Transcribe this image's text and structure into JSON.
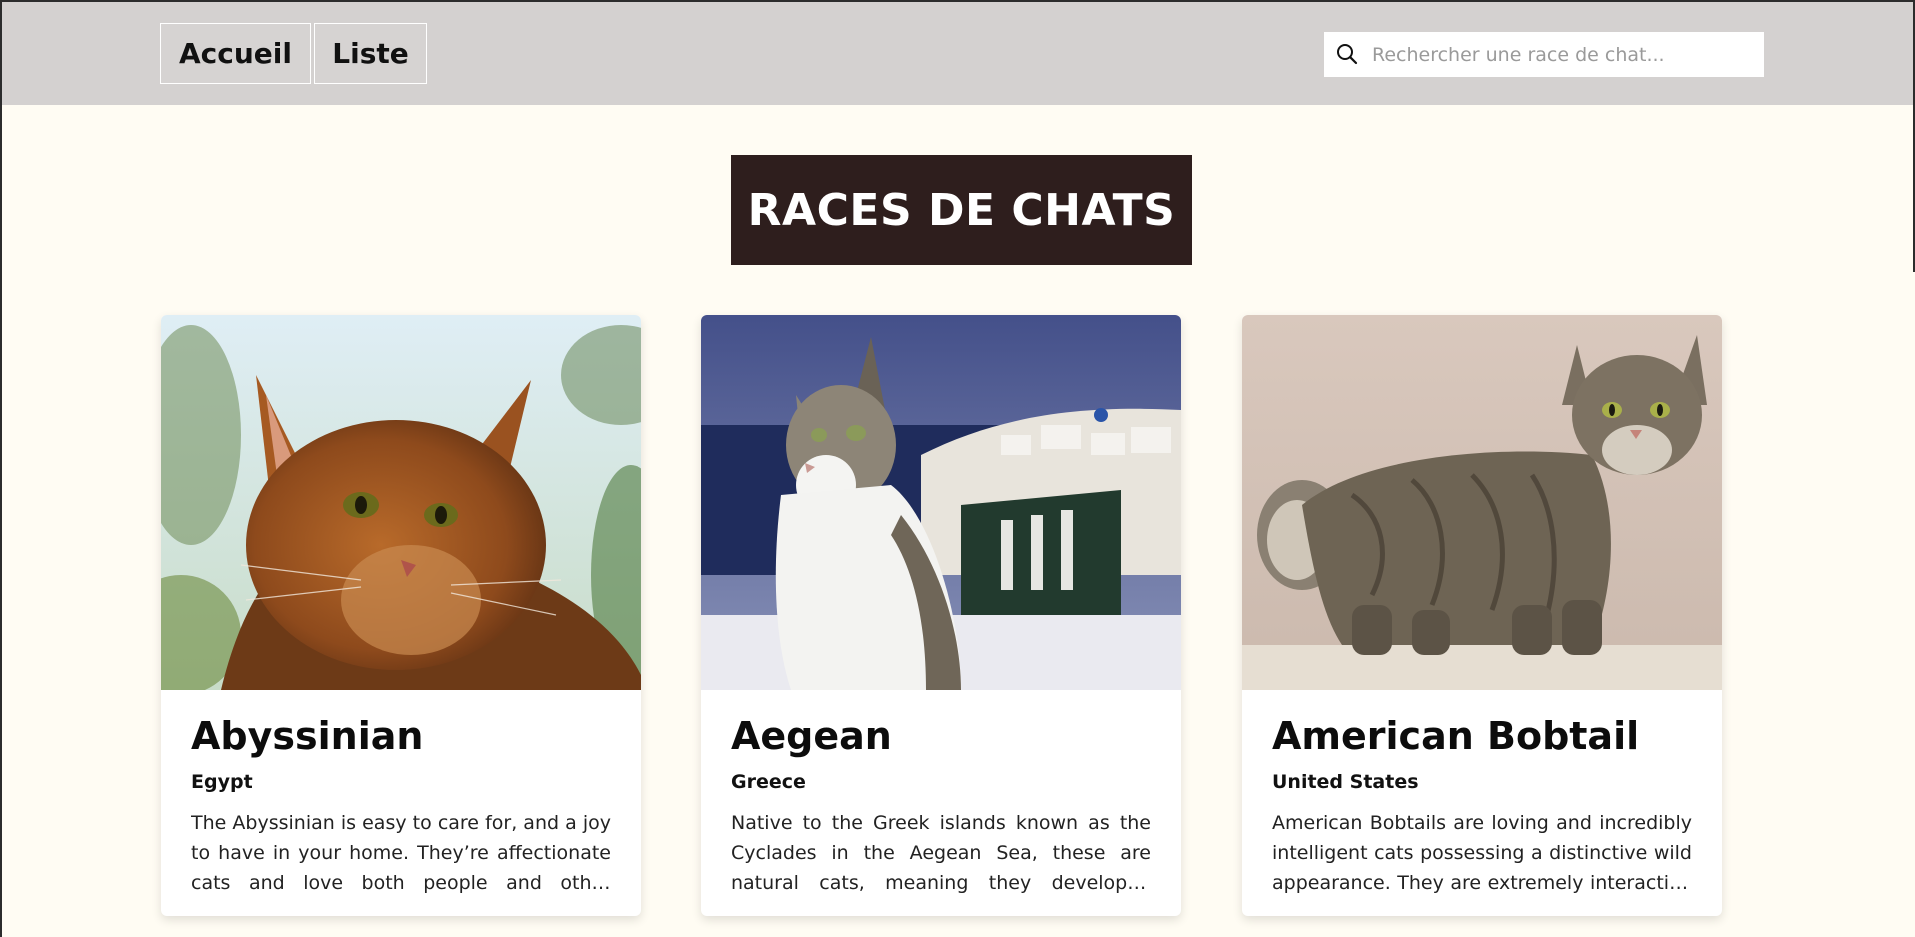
{
  "nav": {
    "home_label": "Accueil",
    "list_label": "Liste"
  },
  "search": {
    "placeholder": "Rechercher une race de chat...",
    "value": ""
  },
  "page": {
    "title": "RACES DE CHATS"
  },
  "cards": [
    {
      "name": "Abyssinian",
      "origin": "Egypt",
      "description": "The Abyssinian is easy to care for, and a joy to have in your home. They’re affectionate cats and love both people and other animals.",
      "image_icon": "abyssinian-cat-photo"
    },
    {
      "name": "Aegean",
      "origin": "Greece",
      "description": "Native to the Greek islands known as the Cyclades in the Aegean Sea, these are natural cats, meaning they developed without human intervention.",
      "image_icon": "aegean-cat-photo"
    },
    {
      "name": "American Bobtail",
      "origin": "United States",
      "description": "American Bobtails are loving and incredibly intelligent cats possessing a distinctive wild appearance. They are extremely interactive cats that bond with their human family.",
      "image_icon": "american-bobtail-cat-photo"
    }
  ],
  "colors": {
    "header_bg": "#d4d1d0",
    "page_bg": "#fffcf3",
    "title_bg": "#2e1e1d",
    "title_text": "#ffffff"
  }
}
